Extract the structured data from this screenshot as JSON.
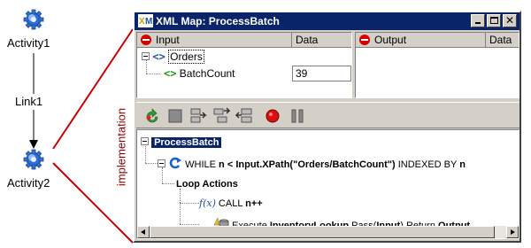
{
  "diagram": {
    "activity1_label": "Activity1",
    "link_label": "Link1",
    "activity2_label": "Activity2",
    "implementation_label": "implementation",
    "accent_color": "#cc0000"
  },
  "window": {
    "title": "XML Map: ProcessBatch",
    "title_icon": "xml-map-icon",
    "controls": [
      "minimize-icon",
      "maximize-icon",
      "close-icon"
    ],
    "close_glyph": "✕"
  },
  "input_pane": {
    "header_label": "Input",
    "data_header": "Data",
    "tree": [
      {
        "icon": "xml-element-icon",
        "glyph": "<>",
        "label": "Orders",
        "data": ""
      },
      {
        "icon": "xml-element-icon",
        "glyph": "<>",
        "label": "BatchCount",
        "data": "39"
      }
    ]
  },
  "output_pane": {
    "header_label": "Output",
    "data_header": "Data"
  },
  "toolbar": {
    "icons": [
      "undo-icon",
      "stop-icon",
      "insert-icon",
      "insert-child-icon",
      "delete-icon",
      "record-icon",
      "pause-icon"
    ]
  },
  "flow": {
    "root_label": "ProcessBatch",
    "while": {
      "keyword": "WHILE",
      "var": "n",
      "op": "<",
      "expr": "Input.XPath(\"Orders/BatchCount\")",
      "indexed": "INDEXED BY",
      "index": "n"
    },
    "loop_actions_label": "Loop Actions",
    "call": {
      "keyword": "CALL",
      "expr": "n++",
      "icon_glyph": "f(x)"
    },
    "execute": {
      "keyword": "Execute",
      "target": "InventoryLookup",
      "pass_keyword": "Pass",
      "pass_arg": "Input",
      "return_keyword": "Return",
      "return_value": "Output"
    }
  }
}
